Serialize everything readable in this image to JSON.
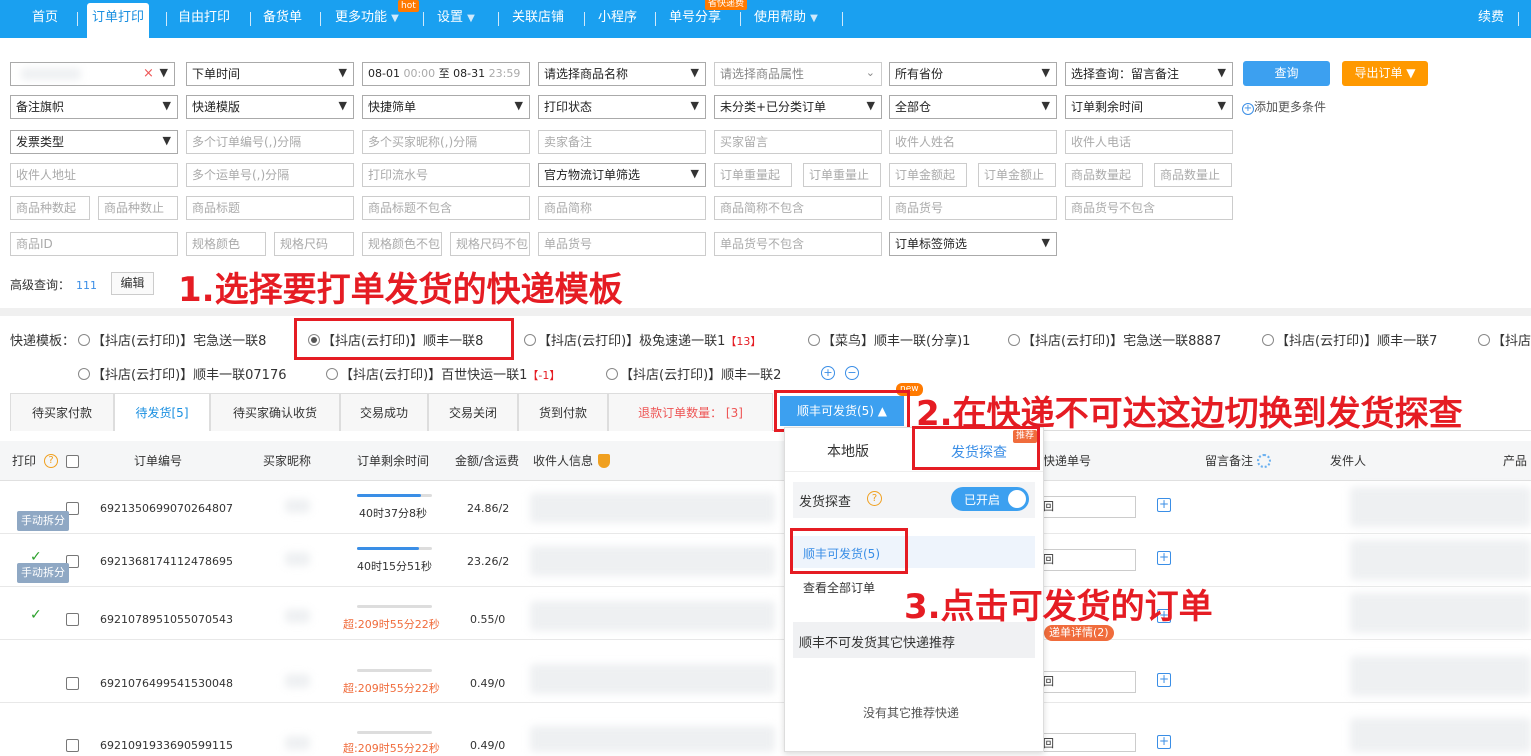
{
  "nav": {
    "items": [
      "首页",
      "订单打印",
      "自由打印",
      "备货单",
      "更多功能",
      "设置",
      "关联店铺",
      "小程序",
      "单号分享",
      "使用帮助"
    ],
    "more_arrow": "▼",
    "hot_badge": "hot",
    "share_badge": "省快递费",
    "renew": "续费"
  },
  "filters": {
    "shop_clear": "×",
    "order_time": "下单时间",
    "date_start": "08-01",
    "date_start_time": "00:00",
    "date_to": "至",
    "date_end": "08-31",
    "date_end_time": "23:59",
    "product_name": "请选择商品名称",
    "product_attr": "请选择商品属性",
    "province": "所有省份",
    "query_type": "选择查询：留言备注",
    "search_btn": "查询",
    "export_btn": "导出订单 ▼",
    "remark_flag": "备注旗帜",
    "express_tpl": "快递模版",
    "quick_filter": "快捷筛单",
    "print_status": "打印状态",
    "category": "未分类+已分类订单",
    "warehouse": "全部仓",
    "remaining_time": "订单剩余时间",
    "add_more": "添加更多条件",
    "invoice_type": "发票类型",
    "order_nos": "多个订单编号(,)分隔",
    "buyer_nicks": "多个买家昵称(,)分隔",
    "seller_remark": "卖家备注",
    "buyer_msg": "买家留言",
    "receiver_name": "收件人姓名",
    "receiver_phone": "收件人电话",
    "receiver_addr": "收件人地址",
    "waybill_nos": "多个运单号(,)分隔",
    "print_serial": "打印流水号",
    "logistics_filter": "官方物流订单筛选",
    "weight_from": "订单重量起",
    "weight_to": "订单重量止",
    "amount_from": "订单金额起",
    "amount_to": "订单金额止",
    "qty_from": "商品数量起",
    "qty_to": "商品数量止",
    "kinds_from": "商品种数起",
    "kinds_to": "商品种数止",
    "product_title": "商品标题",
    "title_exclude": "商品标题不包含",
    "short_name": "商品简称",
    "short_exclude": "商品简称不包含",
    "item_no": "商品货号",
    "item_no_exclude": "商品货号不包含",
    "product_id": "商品ID",
    "spec_color": "规格颜色",
    "spec_size": "规格尺码",
    "spec_color_ex": "规格颜色不包",
    "spec_size_ex": "规格尺码不包",
    "single_no": "单品货号",
    "single_no_ex": "单品货号不包含",
    "order_tag": "订单标签筛选",
    "adv_label": "高级查询：",
    "adv_count": "111",
    "edit_btn": "编辑"
  },
  "annotations": {
    "step1": "1.选择要打单发货的快递模板",
    "step2": "2.在快递不可达这边切换到发货探查",
    "step3": "3.点击可发货的订单"
  },
  "templates": {
    "label": "快递模板：",
    "items": [
      {
        "text": "【抖店(云打印)】宅急送一联8",
        "count": "",
        "selected": false
      },
      {
        "text": "【抖店(云打印)】顺丰一联8",
        "count": "",
        "selected": true
      },
      {
        "text": "【抖店(云打印)】极兔速递一联1",
        "count": "【13】",
        "selected": false
      },
      {
        "text": "【菜鸟】顺丰一联(分享)1",
        "count": "",
        "selected": false
      },
      {
        "text": "【抖店(云打印)】宅急送一联8887",
        "count": "",
        "selected": false
      },
      {
        "text": "【抖店(云打印)】顺丰一联7",
        "count": "",
        "selected": false
      },
      {
        "text": "【抖店",
        "count": "",
        "selected": false
      },
      {
        "text": "【抖店(云打印)】顺丰一联07176",
        "count": "",
        "selected": false
      },
      {
        "text": "【抖店(云打印)】百世快运一联1",
        "count": "【-1】",
        "selected": false
      },
      {
        "text": "【抖店(云打印)】顺丰一联2",
        "count": "",
        "selected": false
      }
    ],
    "add_icon": "+",
    "remove_icon": "−"
  },
  "tabs": [
    "待买家付款",
    "待发货[5]",
    "待买家确认收货",
    "交易成功",
    "交易关闭",
    "货到付款",
    "退款订单数量： [3]"
  ],
  "sf_tab": {
    "label": "顺丰可发货(5)",
    "arrow": "▲",
    "new_badge": "new"
  },
  "headers": {
    "print": "打印",
    "order_no": "订单编号",
    "buyer": "买家昵称",
    "remaining": "订单剩余时间",
    "amount": "金额/含运费",
    "receiver": "收件人信息",
    "tracking": "快递单号",
    "remark": "留言备注",
    "sender": "发件人",
    "product": "产品"
  },
  "rows": [
    {
      "order_no": "6921350699070264807",
      "time": "40时37分8秒",
      "amount": "24.86/2",
      "split": "手动拆分",
      "progress": 0.85,
      "over": false,
      "tick": false,
      "track": "回",
      "track_detail": ""
    },
    {
      "order_no": "6921368174112478695",
      "time": "40时15分51秒",
      "amount": "23.26/2",
      "split": "手动拆分",
      "progress": 0.82,
      "over": false,
      "tick": true,
      "track": "回",
      "track_detail": ""
    },
    {
      "order_no": "6921078951055070543",
      "time": "超:209时55分22秒",
      "amount": "0.55/0",
      "split": "",
      "progress": 0.0,
      "over": true,
      "tick": true,
      "track": "",
      "track_detail": "递单详情(2)"
    },
    {
      "order_no": "6921076499541530048",
      "time": "超:209时55分22秒",
      "amount": "0.49/0",
      "split": "",
      "progress": 0.0,
      "over": true,
      "tick": false,
      "track": "回",
      "track_detail": ""
    },
    {
      "order_no": "6921091933690599115",
      "time": "超:209时55分22秒",
      "amount": "0.49/0",
      "split": "",
      "progress": 0.0,
      "over": true,
      "tick": false,
      "track": "回",
      "track_detail": ""
    }
  ],
  "dropdown": {
    "tab_local": "本地版",
    "tab_probe": "发货探查",
    "recommend_badge": "推荐",
    "probe_label": "发货探查",
    "help_icon": "?",
    "toggle": "已开启",
    "sf_ok": "顺丰可发货(5)",
    "view_all": "查看全部订单",
    "sf_not": "顺丰不可发货其它快递推荐",
    "no_other": "没有其它推荐快递"
  },
  "colors": {
    "nav": "#1aa0f0",
    "accent": "#1a8fe0",
    "annotation": "#e51c23",
    "orange": "#ff9900"
  }
}
